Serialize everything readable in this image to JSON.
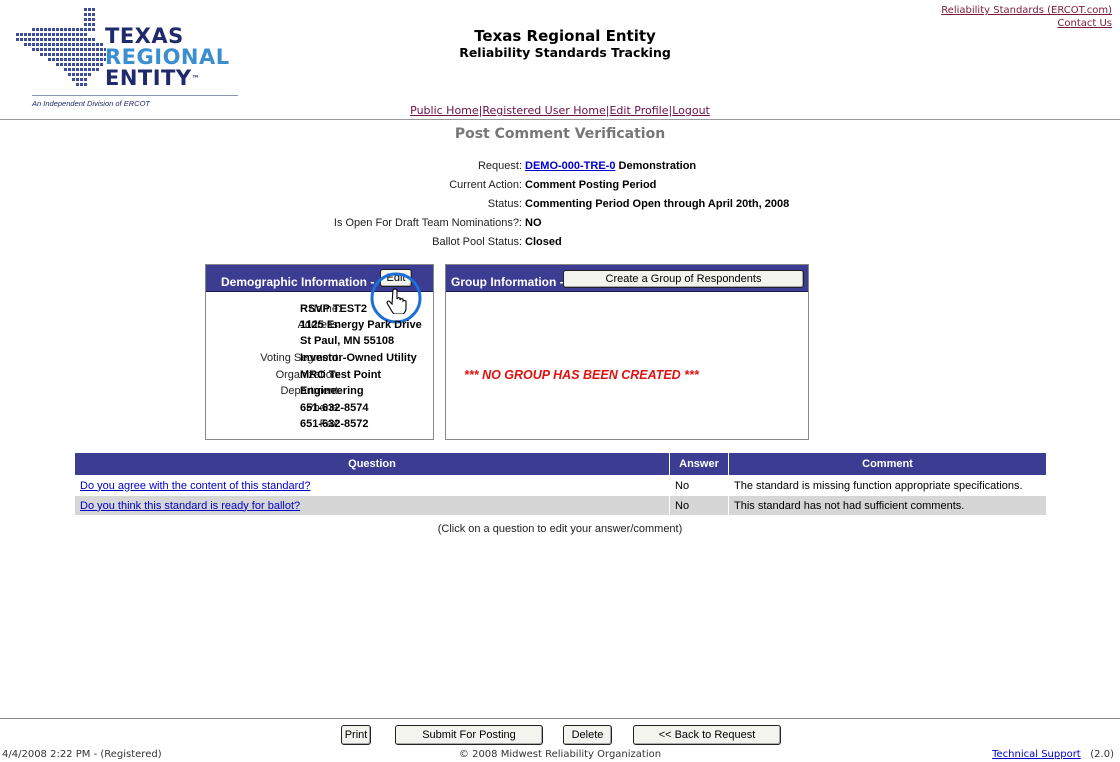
{
  "header": {
    "logo": {
      "line1": "TEXAS",
      "line2": "REGIONAL",
      "line3": "ENTITY",
      "tm": "™",
      "tagline": "An Independent Division of ERCOT"
    },
    "title1": "Texas Regional Entity",
    "title2": "Reliability Standards Tracking",
    "top_links": [
      "Reliability Standards (ERCOT.com)",
      "Contact Us"
    ],
    "nav_links": [
      "Public Home",
      "Registered User Home",
      "Edit Profile",
      "Logout"
    ]
  },
  "page_heading": "Post Comment Verification",
  "info": [
    {
      "label": "Request:",
      "link": "DEMO-000-TRE-0",
      "value": " Demonstration"
    },
    {
      "label": "Current Action:",
      "value": "Comment Posting Period"
    },
    {
      "label": "Status:",
      "value": "Commenting Period Open through April 20th, 2008"
    },
    {
      "label": "Is Open For Draft Team Nominations?:",
      "value": "NO"
    },
    {
      "label": "Ballot Pool Status:",
      "value": "Closed"
    }
  ],
  "demographic": {
    "header": "Demographic Information",
    "dash": "-",
    "edit_label": "Edit",
    "rows": [
      {
        "label": "Name:",
        "value": "RSVP TEST2"
      },
      {
        "label": "Address:",
        "value": "1125 Energy Park Drive"
      },
      {
        "label": "",
        "value": "St Paul, MN 55108"
      },
      {
        "label": "Voting Segment:",
        "value": "Investor-Owned Utility"
      },
      {
        "label": "Organization:",
        "value": "MRO Test Point"
      },
      {
        "label": "Department:",
        "value": "Engineering"
      },
      {
        "label": "Phone:",
        "value": "651-632-8574"
      },
      {
        "label": "Fax:",
        "value": "651-632-8572"
      }
    ]
  },
  "group": {
    "header": "Group Information -",
    "create_label": "Create a Group of Respondents",
    "empty_message": "*** NO GROUP HAS BEEN CREATED ***"
  },
  "questions": {
    "headers": [
      "Question",
      "Answer",
      "Comment"
    ],
    "rows": [
      {
        "question": "Do you agree with the content of this standard?",
        "answer": "No",
        "comment": "The standard is missing function appropriate specifications."
      },
      {
        "question": "Do you think this standard is ready for ballot?",
        "answer": "No",
        "comment": "This standard has not had sufficient comments."
      }
    ],
    "hint": "(Click on a question to edit your answer/comment)"
  },
  "buttons": {
    "print": "Print",
    "submit": "Submit For Posting",
    "delete": "Delete",
    "back": "<< Back to Request"
  },
  "footer": {
    "timestamp": "4/4/2008 2:22 PM - (Registered)",
    "copyright": "© 2008 Midwest Reliability Organization",
    "support": "Technical Support",
    "version": "(2.0)"
  },
  "colors": {
    "header_bar": "#3c3c92",
    "error_text": "#e01010",
    "nav_link": "#6b0f4a",
    "highlight_circle": "#1e6fd8"
  }
}
